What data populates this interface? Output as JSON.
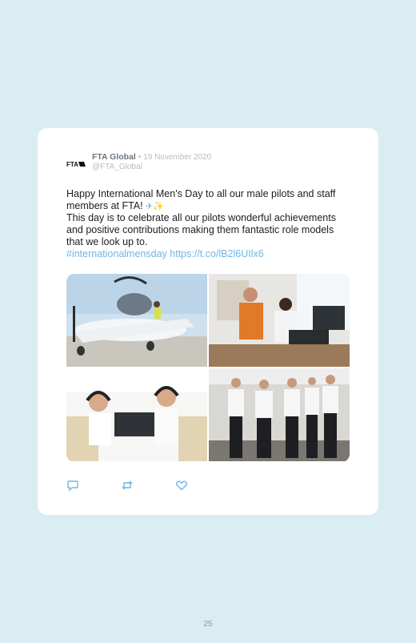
{
  "tweet": {
    "author_name": "FTA Global",
    "separator": "•",
    "date": "19 November 2020",
    "handle": "@FTA_Global",
    "avatar_icon": "fta-logo-icon",
    "avatar_logo_text": "FTA",
    "text_line1": "Happy International Men's Day to all our male pilots and staff members at FTA! ",
    "sparkle_emoji": "✈✨",
    "text_line2": "This day is to celebrate all our pilots wonderful achievements and positive contributions making them fantastic role models that we look up to.",
    "hashtag": "#internationalmensday",
    "link": "https://t.co/lB2l6UIlx6",
    "photos": [
      {
        "icon": "aircraft-photo"
      },
      {
        "icon": "briefing-photo"
      },
      {
        "icon": "cockpit-photo"
      },
      {
        "icon": "pilots-group-photo"
      }
    ],
    "actions": [
      {
        "icon": "reply-icon"
      },
      {
        "icon": "retweet-icon"
      },
      {
        "icon": "like-icon"
      }
    ]
  },
  "page_number": "25",
  "colors": {
    "background": "#daedf3",
    "link": "#6fb6e4",
    "muted": "#b4bcc4",
    "name": "#6d7780"
  }
}
